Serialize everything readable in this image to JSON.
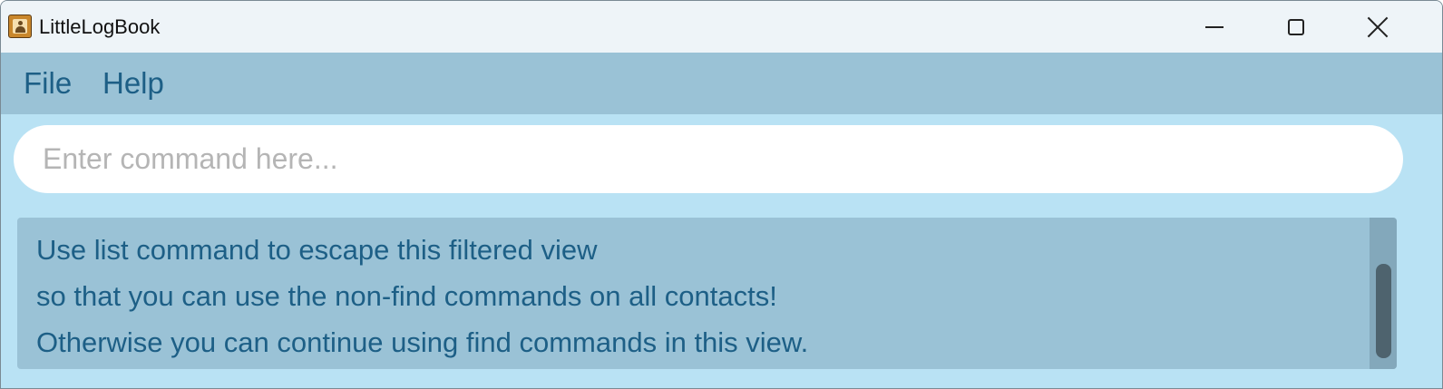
{
  "window": {
    "title": "LittleLogBook",
    "icon": "address-book-icon",
    "controls": {
      "minimize": "minimize-icon",
      "maximize": "maximize-icon",
      "close": "close-icon"
    }
  },
  "menubar": {
    "items": [
      {
        "label": "File"
      },
      {
        "label": "Help"
      }
    ]
  },
  "command": {
    "value": "",
    "placeholder": "Enter command here..."
  },
  "result": {
    "lines": [
      "Use list command to escape this filtered view",
      "so that you can use the non-find commands on all contacts!",
      "Otherwise you can continue using find commands in this view."
    ]
  },
  "colors": {
    "titlebar": "#eef4f8",
    "menubar": "#9ac2d6",
    "background": "#b9e2f4",
    "text_accent": "#1d5f86",
    "scroll_thumb": "#4e636e"
  }
}
